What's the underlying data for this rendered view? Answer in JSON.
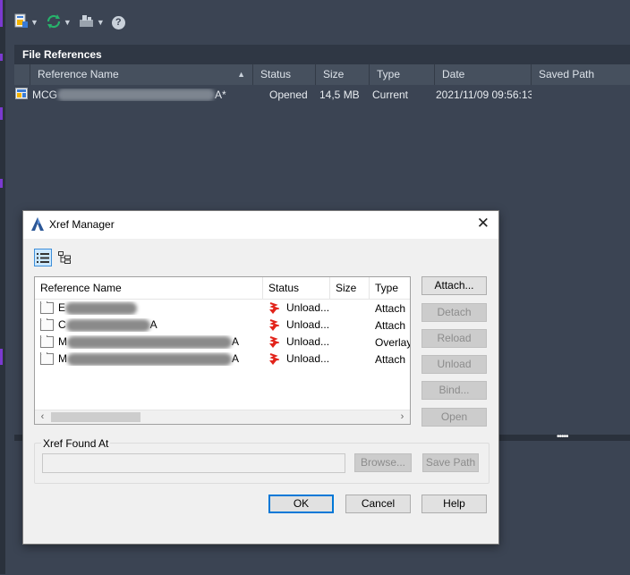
{
  "panel": {
    "section_title": "File References",
    "columns": [
      "Reference Name",
      "Status",
      "Size",
      "Type",
      "Date",
      "Saved Path"
    ],
    "row": {
      "name_start": "MCG",
      "name_end": "A*",
      "status": "Opened",
      "size": "14,5 MB",
      "type": "Current",
      "date": "2021/11/09 09:56:13",
      "saved_path": ""
    }
  },
  "toolbar": {
    "icons": [
      "attach-dwg-icon",
      "refresh-icon",
      "change-path-icon",
      "help-icon"
    ],
    "help_label": "?"
  },
  "dialog": {
    "title": "Xref Manager",
    "close_label": "✕",
    "columns": [
      "Reference Name",
      "Status",
      "Size",
      "Type"
    ],
    "rows": [
      {
        "name_start": "E",
        "name_end": "",
        "status": "Unload...",
        "size": "",
        "type": "Attach"
      },
      {
        "name_start": "C",
        "name_end": "A",
        "status": "Unload...",
        "size": "",
        "type": "Attach"
      },
      {
        "name_start": "M",
        "name_end": "A",
        "status": "Unload...",
        "size": "",
        "type": "Overlay"
      },
      {
        "name_start": "M",
        "name_end": "A",
        "status": "Unload...",
        "size": "",
        "type": "Attach"
      }
    ],
    "side_buttons": {
      "attach": "Attach...",
      "detach": "Detach",
      "reload": "Reload",
      "unload": "Unload",
      "bind": "Bind...",
      "open": "Open"
    },
    "found_at_label": "Xref Found At",
    "found_at_value": "",
    "browse_label": "Browse...",
    "save_path_label": "Save Path",
    "ok_label": "OK",
    "cancel_label": "Cancel",
    "help_label": "Help",
    "scroll_left": "‹",
    "scroll_right": "›"
  },
  "colors": {
    "accent": "#0078d7",
    "unload_arrow": "#e2231a",
    "logo": "#2b5797"
  }
}
